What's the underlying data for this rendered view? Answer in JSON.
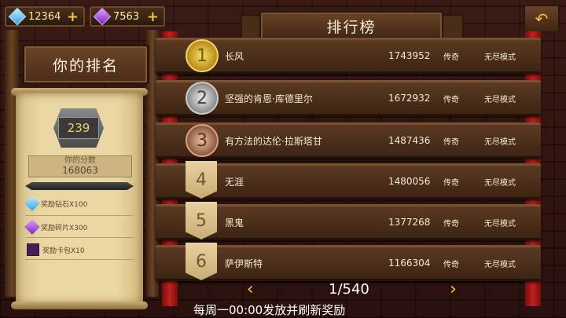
{
  "currency": {
    "diamonds": "12364",
    "shards": "7563",
    "icons": [
      "diamond-icon",
      "purple-shard-icon",
      "plus-icon"
    ]
  },
  "left_panel": {
    "title": "你的排名",
    "rank": "239",
    "score_label": "你的分数",
    "score_value": "168063",
    "rewards": [
      {
        "label": "奖励钻石X100",
        "icon": "diamond-icon"
      },
      {
        "label": "奖励碎片X300",
        "icon": "purple-shard-icon"
      },
      {
        "label": "奖励卡包X10",
        "icon": "card-pack-icon"
      }
    ]
  },
  "header": {
    "title": "排行榜",
    "back_icon": "back-arrow-icon"
  },
  "rows": [
    {
      "rank": "1",
      "medal": "gold",
      "name": "长风",
      "score": "1743952",
      "tier": "传奇",
      "mode": "无尽模式"
    },
    {
      "rank": "2",
      "medal": "silver",
      "name": "坚强的肯恩·库德里尔",
      "score": "1672932",
      "tier": "传奇",
      "mode": "无尽模式"
    },
    {
      "rank": "3",
      "medal": "bronze",
      "name": "有方法的达伦·拉斯塔甘",
      "score": "1487436",
      "tier": "传奇",
      "mode": "无尽模式"
    },
    {
      "rank": "4",
      "medal": "plain",
      "name": "无涯",
      "score": "1480056",
      "tier": "传奇",
      "mode": "无尽模式"
    },
    {
      "rank": "5",
      "medal": "plain",
      "name": "黑鬼",
      "score": "1377268",
      "tier": "传奇",
      "mode": "无尽模式"
    },
    {
      "rank": "6",
      "medal": "plain",
      "name": "萨伊斯特",
      "score": "1166304",
      "tier": "传奇",
      "mode": "无尽模式"
    }
  ],
  "pager": {
    "text": "1/540",
    "prev": "‹",
    "next": "›"
  },
  "footer": {
    "text": "每周一00:00发放并刷新奖励"
  },
  "colors": {
    "accent": "#f6c53b",
    "banner": "#c22020",
    "wood": "#5b3a22",
    "parchment": "#ead7a4"
  }
}
